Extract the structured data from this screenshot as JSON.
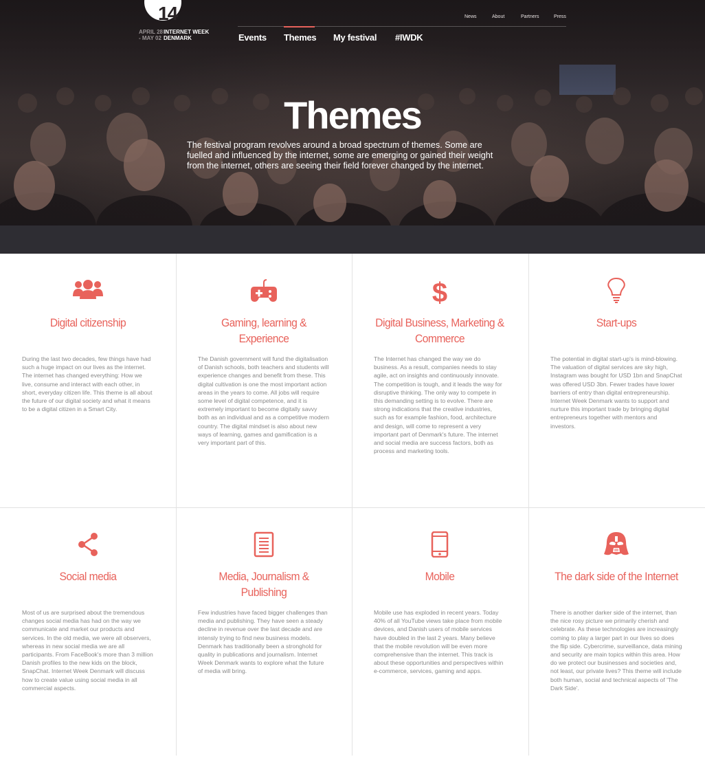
{
  "logo": {
    "number": "14",
    "date_line1": "APRIL 28",
    "date_line2": "- MAY 02",
    "name_line1": "INTERNET WEEK",
    "name_line2": "DENMARK"
  },
  "utility_nav": [
    "News",
    "About",
    "Partners",
    "Press"
  ],
  "main_nav": [
    "Events",
    "Themes",
    "My festival",
    "#IWDK"
  ],
  "hero": {
    "title": "Themes",
    "subtitle": "The festival program revolves around a broad spectrum of themes. Some are fuelled and influenced by the internet, some are emerging or gained their weight from the internet, others are seeing their field forever changed by the internet."
  },
  "colors": {
    "accent": "#e8625b",
    "band": "#2e2d33",
    "body_text": "#888888"
  },
  "themes": [
    {
      "icon": "people-icon",
      "title": "Digital citizenship",
      "text": "During the last two decades, few things have had such a huge impact on our lives as the internet. The internet has changed everything: How we live, consume and interact with each other, in short, everyday citizen life. This theme is all about the future of our digital society and what it means to be a digital citizen in a Smart City."
    },
    {
      "icon": "gamepad-icon",
      "title": "Gaming, learning & Experience",
      "text": "The Danish government will fund the digitalisation of Danish schools, both teachers and students will experience changes and benefit from these. This digital cultivation is one the most important action areas in the years to come. All jobs will require some level of digital competence, and it is extremely important to become digitally savvy both as an individual and as a competitive modern country. The digital mindset is also about new ways of learning, games and gamification is a very important part of this."
    },
    {
      "icon": "dollar-icon",
      "title": "Digital Business, Marketing & Commerce",
      "text": "The Internet has changed the way we do business. As a result, companies needs to stay agile, act on insights and continuously innovate. The competition is tough, and it leads the way for disruptive thinking. The only way to compete in this demanding setting is to evolve. There are strong indications that the creative industries, such as for example fashion, food, architecture and design, will come to represent a very important part of Denmark's future. The internet and social media are success factors, both as process and marketing tools."
    },
    {
      "icon": "lightbulb-icon",
      "title": "Start-ups",
      "text": "The potential in digital start-up's is mind-blowing. The valuation of digital services are sky high, Instagram was bought for USD 1bn and SnapChat was offered USD 3bn. Fewer trades have lower barriers of entry than digital entrepreneurship. Internet Week Denmark wants to support and nurture this important trade by bringing digital entrepreneurs together with mentors and investors."
    },
    {
      "icon": "share-icon",
      "title": "Social media",
      "text": "Most of us are surprised about the tremendous changes social media has had on the way we communicate and market our products and services. In the old media, we were all observers, whereas in new social media we are all participants. From FaceBook's more than 3 million Danish profiles to the new kids on the block, SnapChat. Internet Week Denmark will discuss how to create value using social media in all commercial aspects."
    },
    {
      "icon": "document-icon",
      "title": "Media, Journalism & Publishing",
      "text": "Few industries have faced bigger challenges than media and publishing. They have seen a steady decline in revenue over the last decade and are intensly trying to find new business models. Denmark has traditionally been a stronghold for quality in publications and journalism. Internet Week Denmark wants to explore what the future of media will bring."
    },
    {
      "icon": "mobile-phone-icon",
      "title": "Mobile",
      "text": "Mobile use has exploded in recent years. Today 40% of all YouTube views take place from mobile devices, and Danish users of mobile services have doubled in the last 2 years. Many believe that the mobile revolution will be even more comprehensive than the internet. This track is about these opportunities and perspectives within e-commerce, services, gaming and apps."
    },
    {
      "icon": "darth-vader-icon",
      "title": "The dark side of the Internet",
      "text": "There is another darker side of the internet, than the nice rosy picture we primarily cherish and celebrate. As these technologies are increasingly coming to play a larger part in our lives so does the flip side. Cybercrime, surveillance, data mining and security are main topics within this area. How do we protect our businesses and societies and, not least, our private lives? This theme will include both human, social and technical aspects of 'The Dark Side'."
    }
  ]
}
